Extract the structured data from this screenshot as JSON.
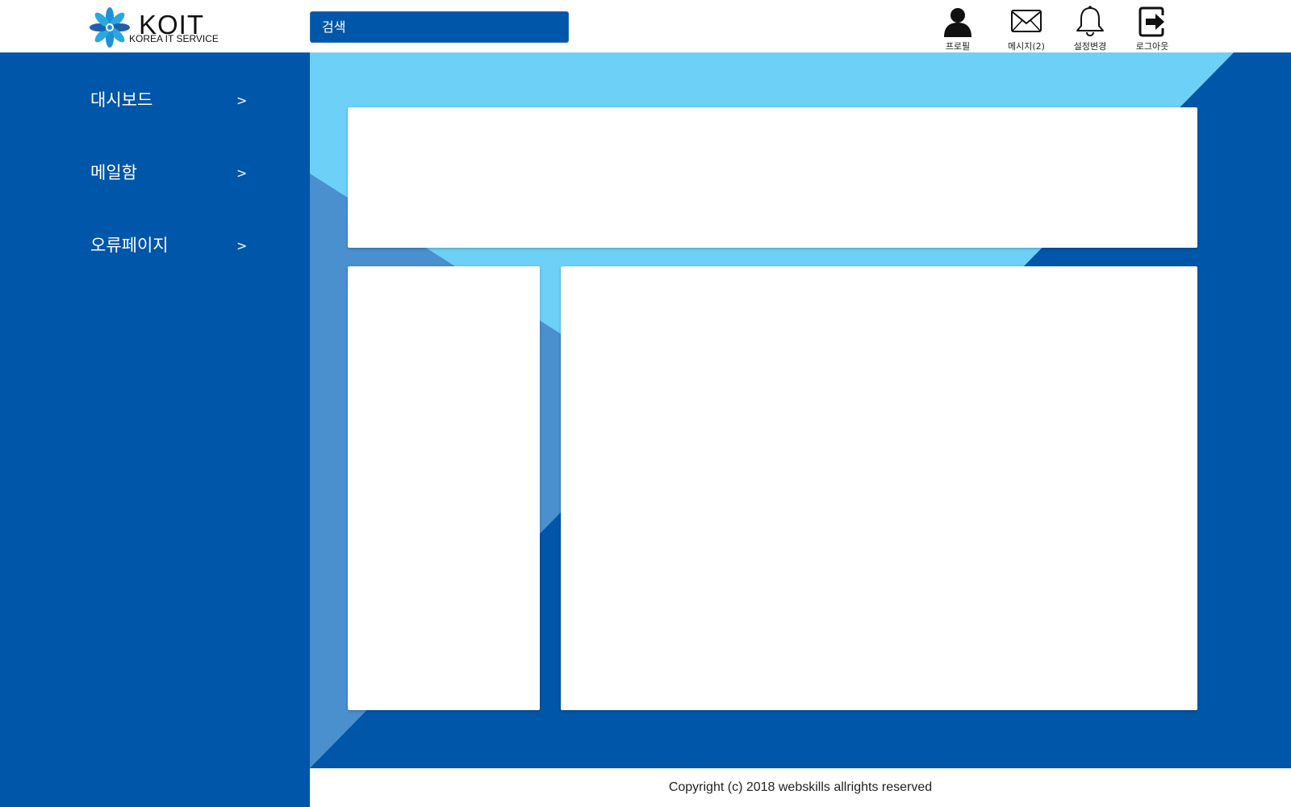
{
  "header": {
    "logo": {
      "title": "KOIT",
      "subtitle": "KOREA IT SERVICE"
    },
    "search": {
      "placeholder": "검색"
    },
    "icons": [
      {
        "icon": "profile-icon",
        "label": "프로필"
      },
      {
        "icon": "mail-icon",
        "label": "메시지(2)"
      },
      {
        "icon": "bell-icon",
        "label": "설정변경"
      },
      {
        "icon": "logout-icon",
        "label": "로그아웃"
      }
    ]
  },
  "sidebar": {
    "items": [
      {
        "label": "대시보드",
        "arrow": ">"
      },
      {
        "label": "메일함",
        "arrow": ">"
      },
      {
        "label": "오류페이지",
        "arrow": ">"
      }
    ]
  },
  "footer": {
    "copyright": "Copyright (c) 2018 webskills allrights reserved"
  },
  "colors": {
    "primary": "#0056a8",
    "light_blue": "#6dd0f7",
    "mid_blue": "#4a8fce",
    "panel": "#ffffff"
  }
}
